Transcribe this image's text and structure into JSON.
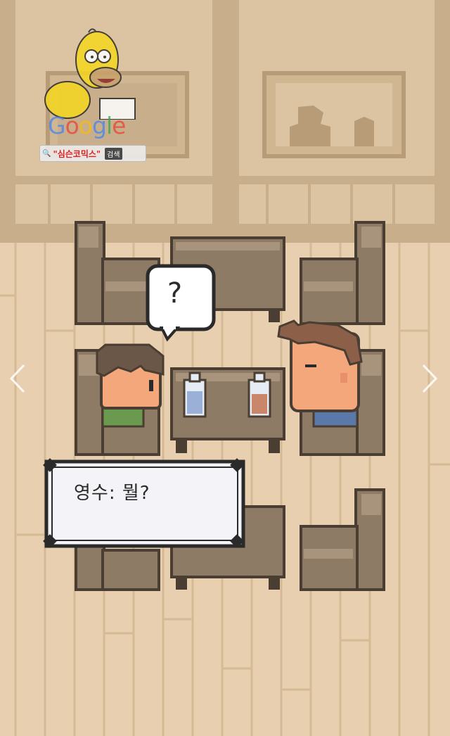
{
  "watermark": {
    "google_text": "Google",
    "google_colors": [
      "#4285f4",
      "#ea4335",
      "#fbbc05",
      "#4285f4",
      "#34a853",
      "#ea4335"
    ],
    "search_term": "\"심슨코믹스\"",
    "search_button": "검색",
    "search_icon": "magnifier-icon"
  },
  "scene": {
    "thought_bubble_text": "?",
    "dialog_text": "영수: 뭘?"
  },
  "navigation": {
    "prev_icon": "chevron-left-icon",
    "next_icon": "chevron-right-icon"
  },
  "palette": {
    "floor": "#e8cfaf",
    "wall": "#dcc3a1",
    "furniture": "#8e7b66",
    "outline": "#4a3e33",
    "dialog_bg": "#f4f4f8"
  }
}
